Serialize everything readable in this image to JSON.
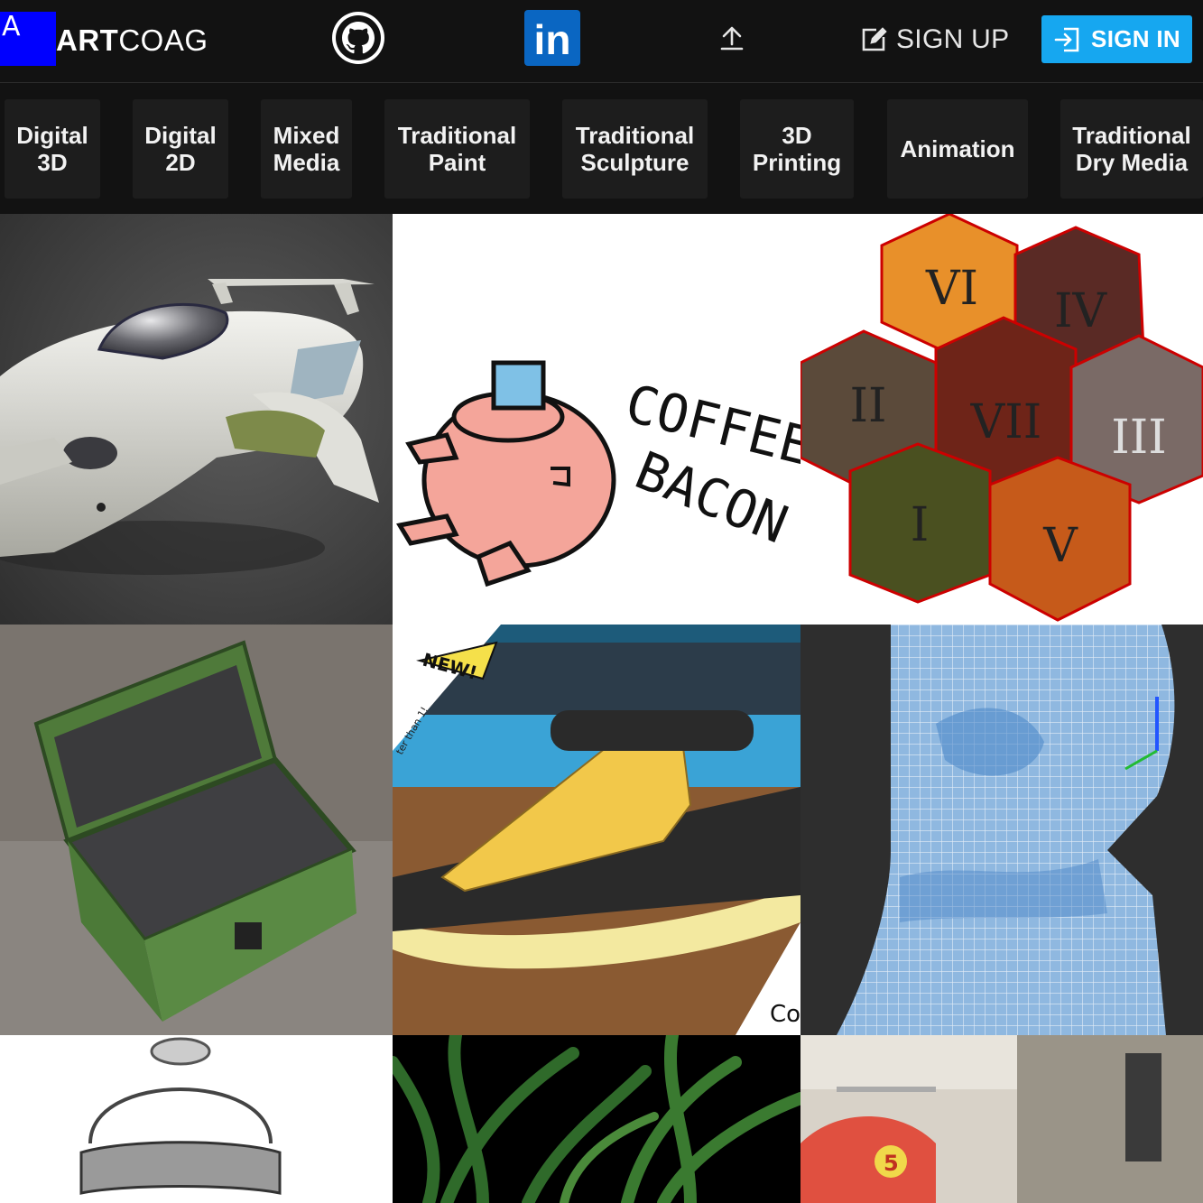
{
  "header": {
    "logo_letter": "A",
    "brand_bold": "ART",
    "brand_regular": "COAG",
    "github_icon": "github-icon",
    "linkedin_icon": "linkedin-icon",
    "linkedin_text": "in",
    "upload_icon": "upload-icon",
    "signup_label": "SIGN UP",
    "signin_label": "SIGN IN",
    "colors": {
      "background": "#121212",
      "logo_box": "#0000ff",
      "signin_bg": "#16a7f0",
      "linkedin_bg": "#0a66c2"
    }
  },
  "categories": [
    {
      "label": "Digital\n3D"
    },
    {
      "label": "Digital\n2D"
    },
    {
      "label": "Mixed\nMedia"
    },
    {
      "label": "Traditional\nPaint"
    },
    {
      "label": "Traditional\nSculpture"
    },
    {
      "label": "3D\nPrinting"
    },
    {
      "label": "Animation"
    },
    {
      "label": "Traditional\nDry Media"
    }
  ],
  "gallery": {
    "coffee_line1": "COFFEE",
    "coffee_line2": "BACON",
    "badge_new": "NEW!",
    "side_text": "ter than 1!",
    "corner_text": "Co",
    "hex_numerals": [
      "VI",
      "IV",
      "II",
      "VII",
      "III",
      "I",
      "V"
    ],
    "scooter_number": "5"
  }
}
